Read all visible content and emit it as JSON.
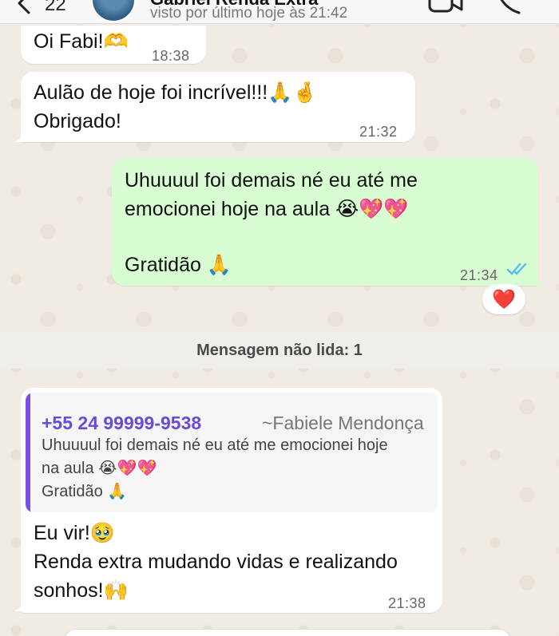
{
  "header": {
    "back_count": "22",
    "contact_name": "Gabriel Renda Extra",
    "last_seen": "visto por último hoje às 21:42"
  },
  "messages": [
    {
      "direction": "in",
      "text": "Oi Fabi!🫶",
      "time": "18:38"
    },
    {
      "direction": "in",
      "line1": "Aulão de hoje foi incrível!!!🙏🤞",
      "line2": "Obrigado!",
      "time": "21:32"
    },
    {
      "direction": "out",
      "line1": "Uhuuuul foi demais né eu até me",
      "line2": "emocionei hoje na aula 😭💖💖",
      "line3": "Gratidão 🙏",
      "time": "21:34",
      "status": "read",
      "reaction": "❤️"
    },
    {
      "direction": "in",
      "quote": {
        "phone": "+55 24 99999-9538",
        "author": "~Fabiele Mendonça",
        "line1": "Uhuuuul foi demais né eu até me emocionei hoje",
        "line2": "na aula 😭💖💖",
        "line3": "Gratidão 🙏"
      },
      "line1": "Eu vir!🥹",
      "line2": "Renda extra mudando vidas e realizando",
      "line3": "sonhos!🙌",
      "time": "21:38"
    }
  ],
  "unread_banner": "Mensagem não lida: 1",
  "colors": {
    "outgoing_bubble": "#d9fdd3",
    "incoming_bubble": "#ffffff",
    "read_ticks": "#53bdeb",
    "quote_accent": "#7b4ee6"
  },
  "icons": [
    "chevron-left-icon",
    "video-call-icon",
    "phone-call-icon",
    "double-check-icon"
  ]
}
